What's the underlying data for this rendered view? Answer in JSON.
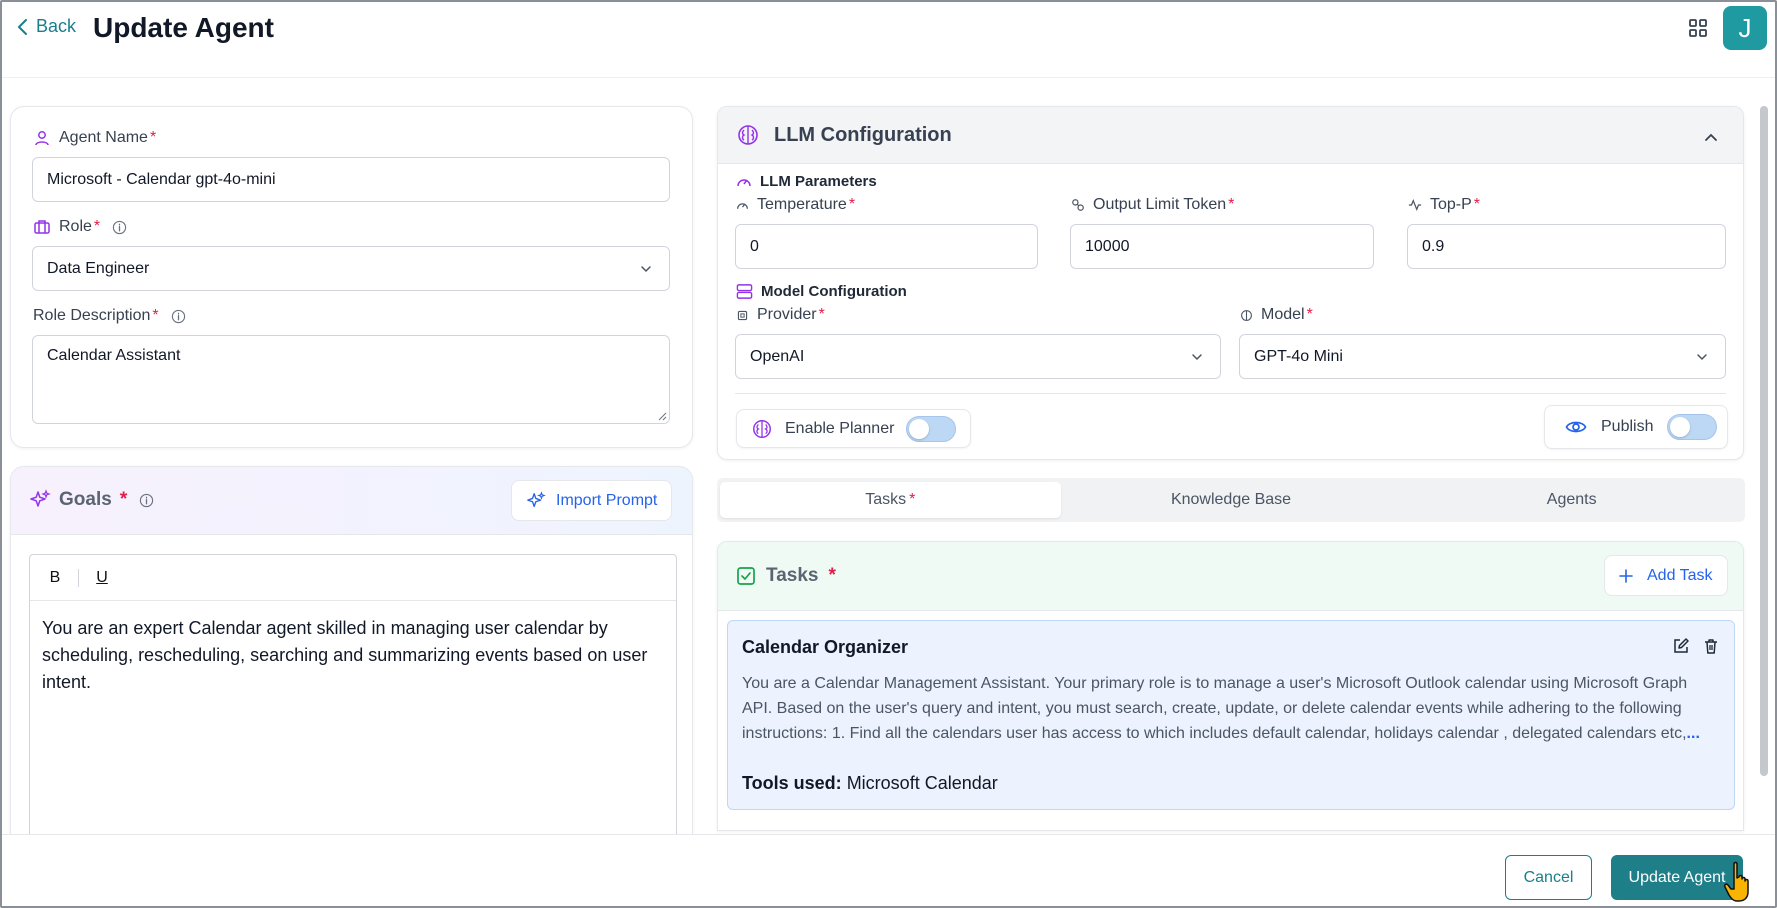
{
  "header": {
    "back_label": "Back",
    "title": "Update Agent",
    "avatar_initial": "J"
  },
  "agent_form": {
    "name_label": "Agent Name",
    "name_value": "Microsoft - Calendar gpt-4o-mini",
    "role_label": "Role",
    "role_value": "Data Engineer",
    "role_description_label": "Role Description",
    "role_description_value": "Calendar Assistant"
  },
  "goals": {
    "title": "Goals",
    "import_label": "Import Prompt",
    "toolbar": {
      "bold": "B",
      "underline": "U"
    },
    "text": "You are an expert Calendar agent skilled in managing user calendar by scheduling, rescheduling, searching and summarizing events based on user intent."
  },
  "llm": {
    "title": "LLM Configuration",
    "params_label": "LLM Parameters",
    "temperature_label": "Temperature",
    "temperature_value": "0",
    "output_limit_label": "Output Limit Token",
    "output_limit_value": "10000",
    "top_p_label": "Top-P",
    "top_p_value": "0.9",
    "model_config_label": "Model Configuration",
    "provider_label": "Provider",
    "provider_value": "OpenAI",
    "model_label": "Model",
    "model_value": "GPT-4o Mini",
    "enable_planner_label": "Enable Planner",
    "enable_planner_on": false,
    "publish_label": "Publish",
    "publish_on": false
  },
  "tabs": [
    {
      "label": "Tasks",
      "active": true,
      "required": true
    },
    {
      "label": "Knowledge Base",
      "active": false,
      "required": false
    },
    {
      "label": "Agents",
      "active": false,
      "required": false
    }
  ],
  "tasks": {
    "title": "Tasks",
    "add_label": "Add Task",
    "items": [
      {
        "name": "Calendar Organizer",
        "description": "You are a Calendar Management Assistant. Your primary role is to manage a user's Microsoft Outlook calendar using Microsoft Graph API. Based on the user's query and intent, you must search, create, update, or delete calendar events while adhering to the following instructions: 1. Find all the calendars user has access to which includes default calendar, holidays calendar , delegated calendars etc,",
        "more": "...",
        "tools_label": "Tools used:",
        "tools_value": "Microsoft Calendar"
      }
    ]
  },
  "footer": {
    "cancel_label": "Cancel",
    "submit_label": "Update Agent"
  },
  "colors": {
    "teal": "#1f7f88",
    "accent_purple": "#9333ea",
    "link_blue": "#2563eb",
    "required_red": "#e11d48",
    "success_green": "#16a34a"
  },
  "icons": [
    "chevron-left-icon",
    "grid-icon",
    "user-icon",
    "briefcase-icon",
    "info-icon",
    "chevron-down-icon",
    "sparkles-icon",
    "brain-icon",
    "chevron-up-icon",
    "gauge-icon",
    "link-icon",
    "activity-icon",
    "server-icon",
    "cpu-icon",
    "eye-icon",
    "check-square-icon",
    "plus-icon",
    "edit-icon",
    "trash-icon",
    "hand-pointer-icon"
  ]
}
